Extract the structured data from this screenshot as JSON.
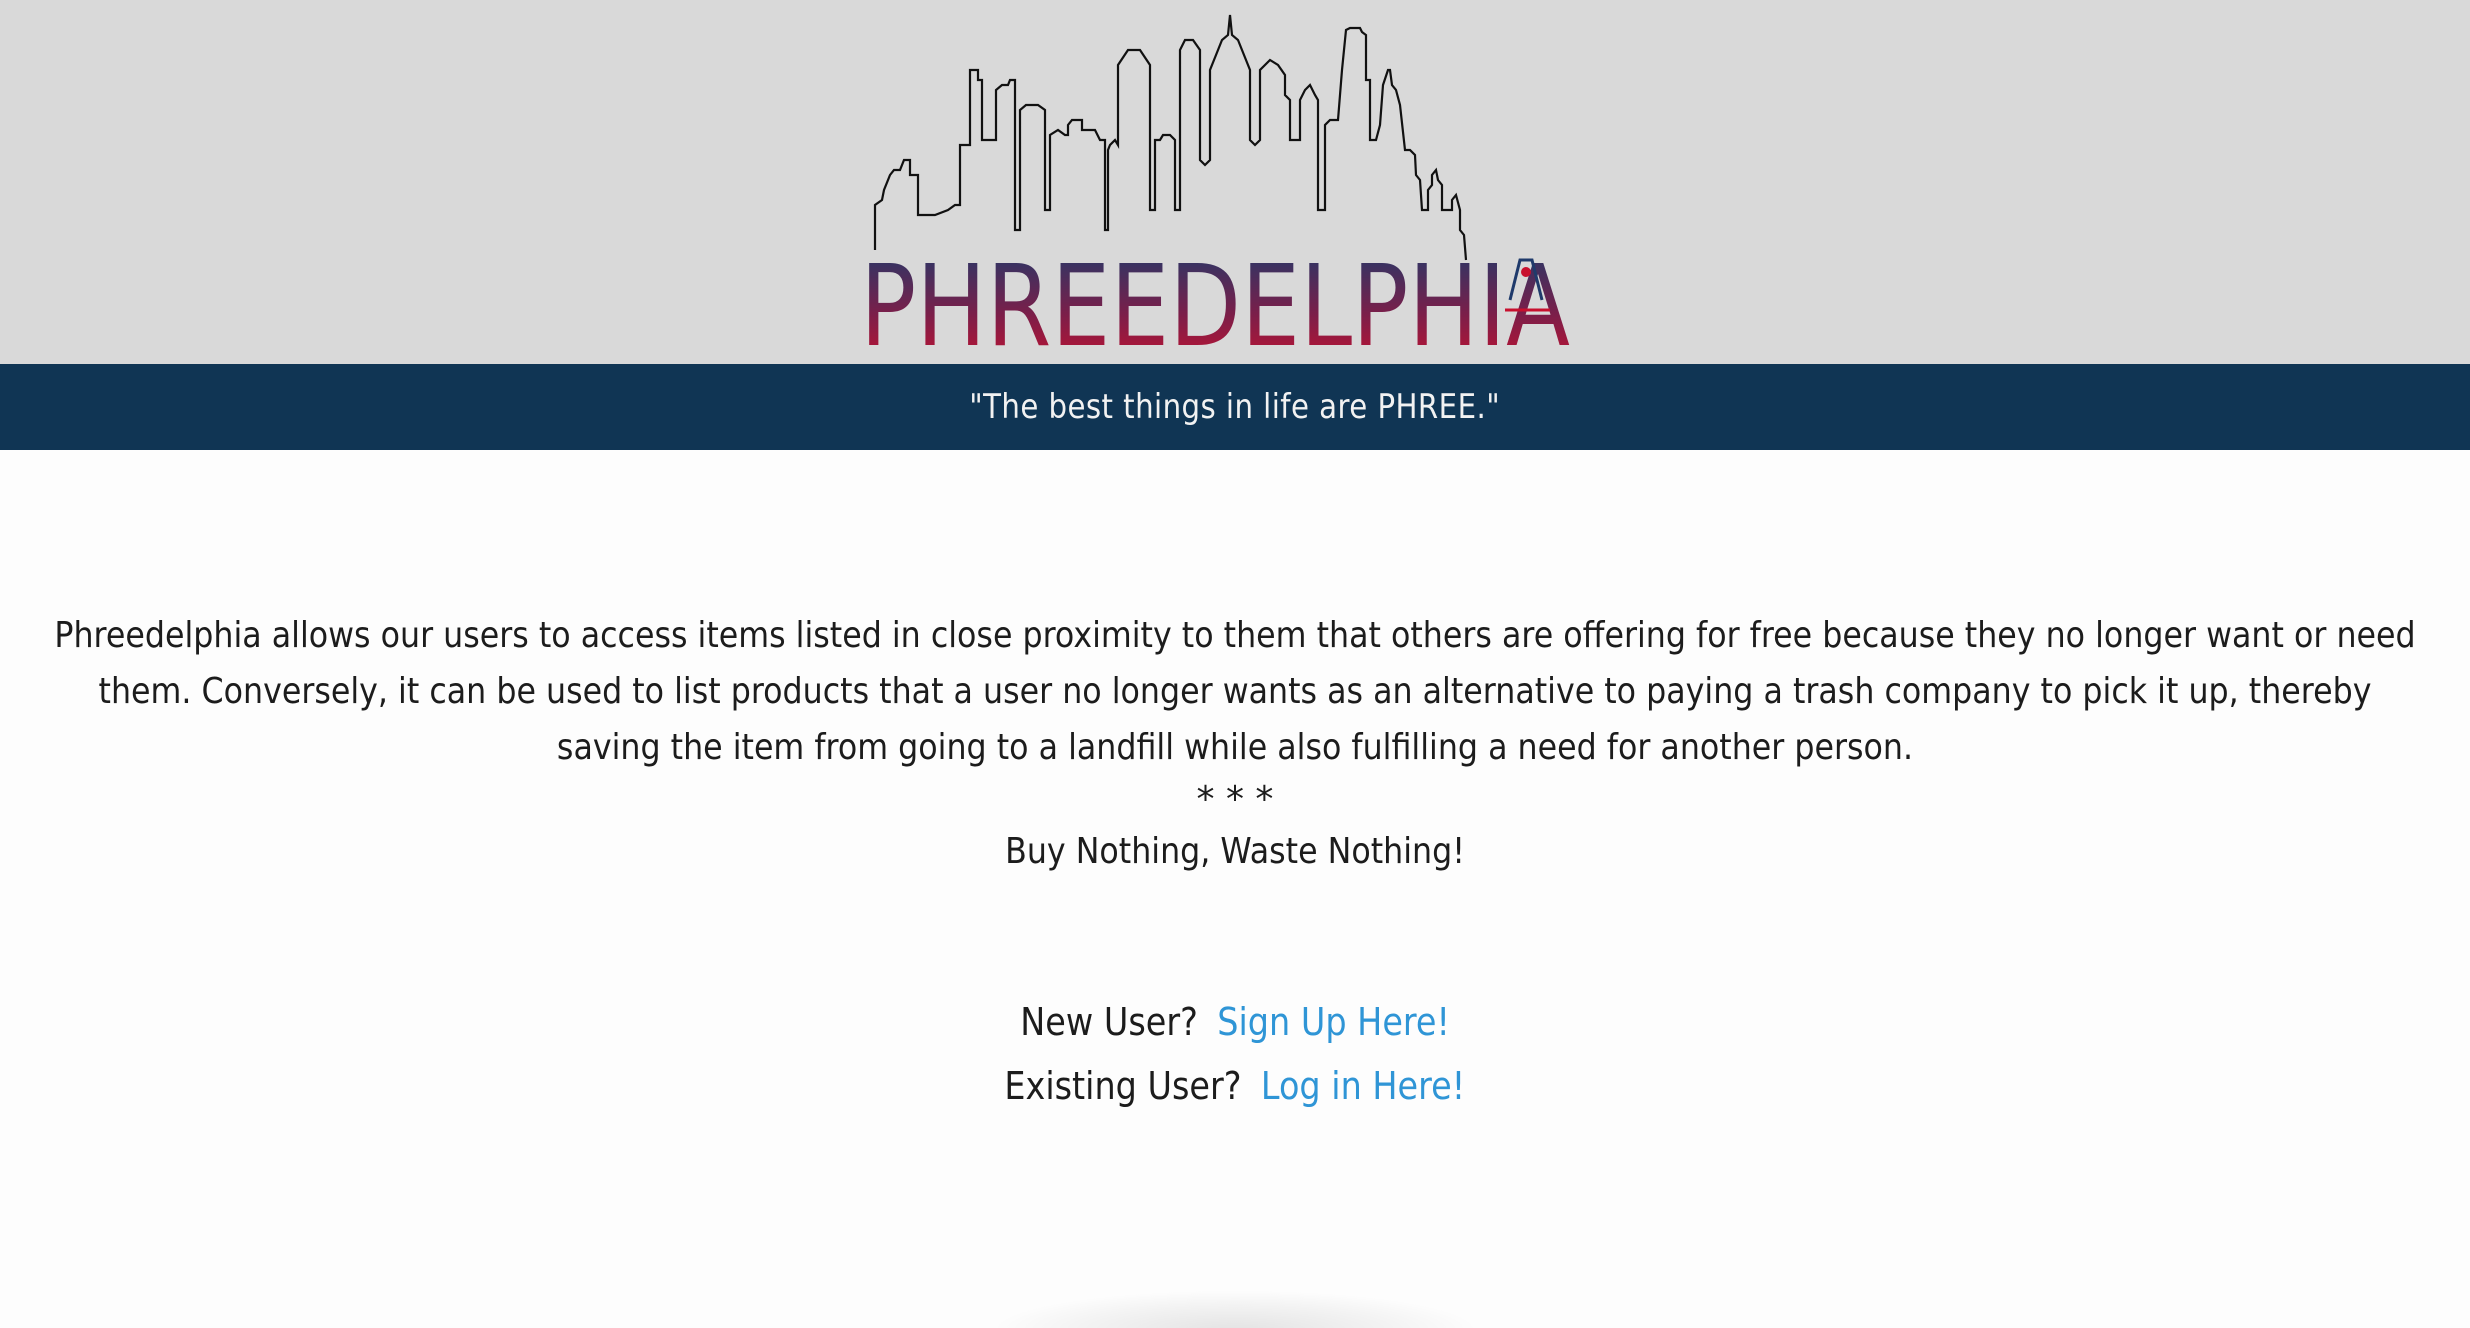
{
  "brand": {
    "name": "PHREEDELPHIA",
    "tagline": "\"The best things in life are PHREE.\"",
    "gradient_top": "#1f3a6b",
    "gradient_bottom": "#c8102e"
  },
  "main": {
    "intro": "Phreedelphia allows our users to access items listed in close proximity to them that others are offering for free because they no longer want or need them. Conversely, it can be used to list products that a user no longer wants as an alternative to paying a trash company to pick it up, thereby saving the item from going to a landfill while also fulfilling a need for another person.",
    "divider": "* * *",
    "slogan": "Buy Nothing, Waste Nothing!"
  },
  "auth": {
    "new_prompt": "New User?",
    "signup_link": "Sign Up Here!",
    "existing_prompt": "Existing User?",
    "login_link": "Log in Here!"
  },
  "colors": {
    "header_bg": "#d9d9d9",
    "tagline_bar": "#103554",
    "link": "#2f95d6"
  }
}
